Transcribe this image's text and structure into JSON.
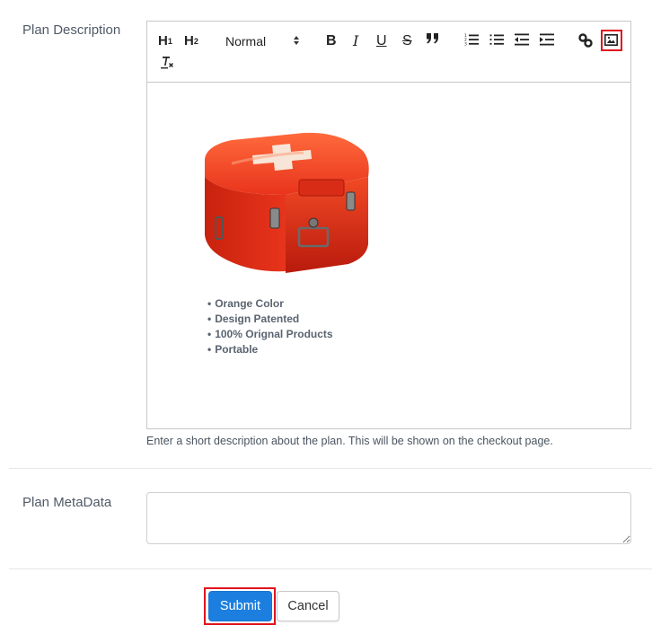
{
  "form": {
    "description": {
      "label": "Plan Description",
      "help_text": "Enter a short description about the plan. This will be shown on the checkout page.",
      "toolbar": {
        "h1": "H",
        "h1_sub": "1",
        "h2": "H",
        "h2_sub": "2",
        "format_select": "Normal",
        "buttons": [
          "header-1",
          "header-2",
          "format-select",
          "bold",
          "italic",
          "underline",
          "strike",
          "blockquote",
          "ordered-list",
          "bullet-list",
          "indent-decrease",
          "indent-increase",
          "link",
          "image",
          "clean-format"
        ],
        "bold": "B",
        "italic": "I",
        "underline": "U",
        "strike": "S",
        "blockquote": "”"
      },
      "content": {
        "image_alt": "Red first-aid case with white cross",
        "bullets": [
          "Orange Color",
          "Design Patented",
          "100% Orignal Products",
          "Portable"
        ]
      }
    },
    "metadata": {
      "label": "Plan MetaData",
      "value": ""
    },
    "actions": {
      "submit_label": "Submit",
      "cancel_label": "Cancel"
    }
  },
  "colors": {
    "primary": "#1c7fe0",
    "highlight": "#e0141e",
    "case_red": "#e8341c"
  }
}
